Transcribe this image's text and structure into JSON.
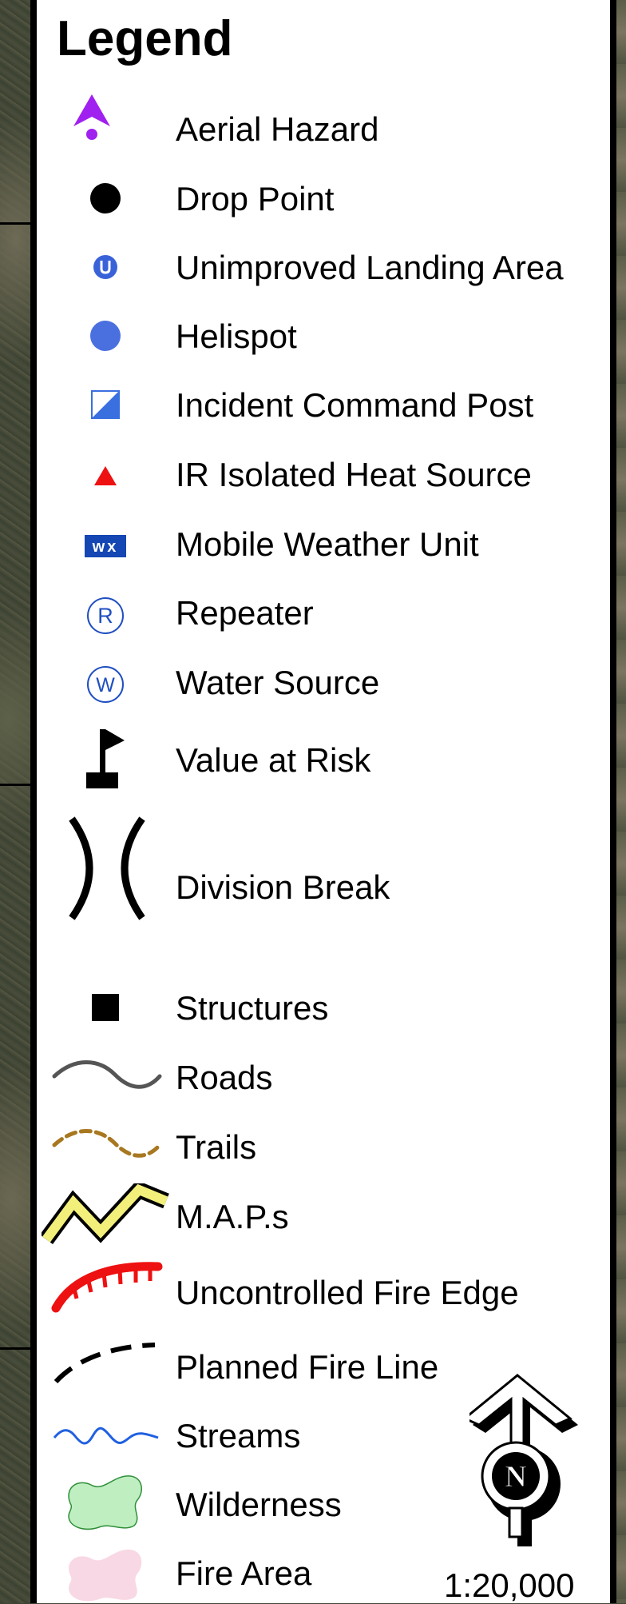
{
  "legend": {
    "title": "Legend",
    "items": [
      {
        "label": "Aerial Hazard",
        "icon": "aerial-hazard-icon",
        "color": "#a020f0"
      },
      {
        "label": "Drop Point",
        "icon": "drop-point-icon",
        "color": "#000000"
      },
      {
        "label": "Unimproved Landing Area",
        "icon": "unimproved-landing-area-icon",
        "color": "#3a62d8"
      },
      {
        "label": "Helispot",
        "icon": "helispot-icon",
        "color": "#4a70e0"
      },
      {
        "label": "Incident Command Post",
        "icon": "incident-command-post-icon",
        "color": "#3a6fe0"
      },
      {
        "label": "IR Isolated Heat Source",
        "icon": "ir-heat-source-icon",
        "color": "#ee1111"
      },
      {
        "label": "Mobile Weather Unit",
        "icon": "mobile-weather-unit-icon",
        "color": "#1446b4",
        "icon_text": "wx"
      },
      {
        "label": "Repeater",
        "icon": "repeater-icon",
        "color": "#1f4fc0",
        "icon_text": "R"
      },
      {
        "label": "Water Source",
        "icon": "water-source-icon",
        "color": "#1f4fc0",
        "icon_text": "W"
      },
      {
        "label": "Value at Risk",
        "icon": "value-at-risk-icon",
        "color": "#000000"
      },
      {
        "label": "Division Break",
        "icon": "division-break-icon",
        "color": "#000000"
      },
      {
        "label": "Structures",
        "icon": "structures-icon",
        "color": "#000000"
      },
      {
        "label": "Roads",
        "icon": "roads-icon",
        "color": "#555555"
      },
      {
        "label": "Trails",
        "icon": "trails-icon",
        "color": "#a87820"
      },
      {
        "label": "M.A.P.s",
        "icon": "maps-icon",
        "color": "#f2f07a"
      },
      {
        "label": "Uncontrolled Fire Edge",
        "icon": "uncontrolled-fire-edge-icon",
        "color": "#ee1111"
      },
      {
        "label": "Planned Fire Line",
        "icon": "planned-fire-line-icon",
        "color": "#000000"
      },
      {
        "label": "Streams",
        "icon": "streams-icon",
        "color": "#2060e0"
      },
      {
        "label": "Wilderness",
        "icon": "wilderness-icon",
        "color": "#bfefc0"
      },
      {
        "label": "Fire Area",
        "icon": "fire-area-icon",
        "color": "#f8d8e4"
      }
    ]
  },
  "north_arrow": {
    "letter": "N"
  },
  "scale": "1:20,000"
}
